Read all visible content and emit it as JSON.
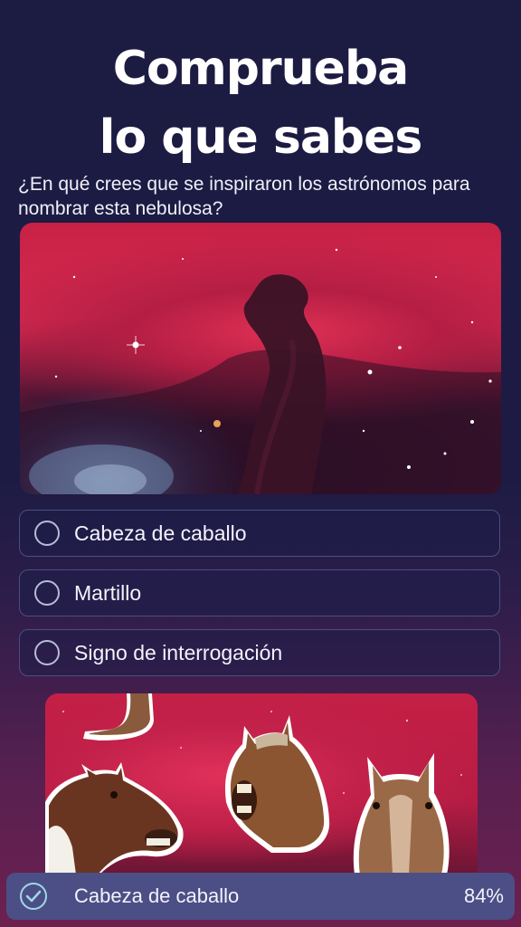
{
  "header": {
    "title_line1": "Comprueba",
    "title_line2": "lo que sabes"
  },
  "question": "¿En qué crees que se inspiraron los astrónomos para nombrar esta nebulosa?",
  "options": [
    {
      "label": "Cabeza de caballo"
    },
    {
      "label": "Martillo"
    },
    {
      "label": "Signo de interrogación"
    }
  ],
  "result": {
    "label": "Cabeza de caballo",
    "percent": "84%",
    "icon": "check-icon"
  },
  "images": {
    "nebula": "horsehead-nebula-photo",
    "stickers": "horse-head-stickers"
  },
  "colors": {
    "background": "#1c1b42",
    "option_border": "#4a4f7e",
    "result_bg": "#4c4f86",
    "check": "#9fd8e6"
  }
}
